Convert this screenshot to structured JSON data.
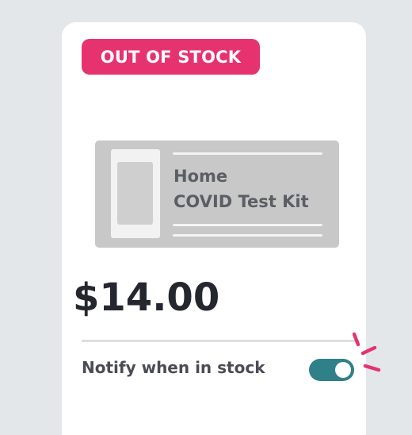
{
  "badge": {
    "label": "OUT OF STOCK",
    "color": "#e6336f"
  },
  "product": {
    "image_title_line1": "Home",
    "image_title_line2": "COVID Test Kit",
    "price": "$14.00"
  },
  "notify": {
    "label": "Notify when in stock",
    "toggle_on": true,
    "toggle_color": "#2f8089",
    "sparkle_color": "#e6336f"
  }
}
